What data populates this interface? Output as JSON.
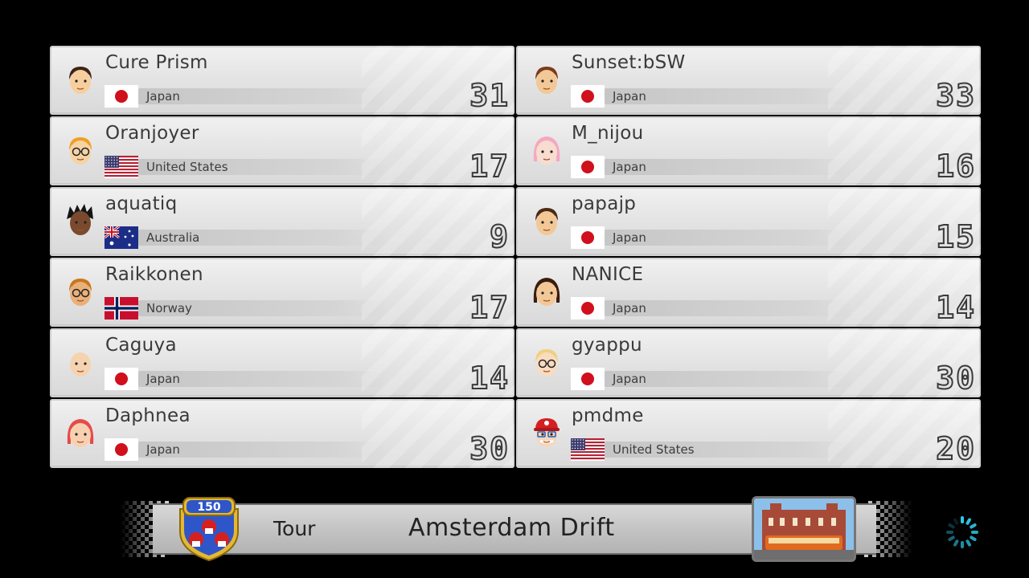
{
  "players": [
    {
      "name": "Cure Prism",
      "country": "Japan",
      "flag": "jp",
      "score": "31",
      "avatar": "mii-brown-hair-icon",
      "skin": "#f7cf9e",
      "hair": "#3b2416"
    },
    {
      "name": "Sunset:bSW",
      "country": "Japan",
      "flag": "jp",
      "score": "33",
      "avatar": "mii-auburn-hair-icon",
      "skin": "#f3c897",
      "hair": "#7a3b1c"
    },
    {
      "name": "Oranjoyer",
      "country": "United States",
      "flag": "us",
      "score": "17",
      "avatar": "mii-glasses-blonde-icon",
      "skin": "#f6d3a4",
      "hair": "#f0a020"
    },
    {
      "name": "M_nijou",
      "country": "Japan",
      "flag": "jp",
      "score": "16",
      "avatar": "mii-pink-hair-icon",
      "skin": "#f8dcd0",
      "hair": "#f4a9c0"
    },
    {
      "name": "aquatiq",
      "country": "Australia",
      "flag": "au",
      "score": "9",
      "avatar": "mii-dark-spiky-icon",
      "skin": "#7a4a2e",
      "hair": "#141414"
    },
    {
      "name": "papajp",
      "country": "Japan",
      "flag": "jp",
      "score": "15",
      "avatar": "mii-brown-hair-icon",
      "skin": "#f3c897",
      "hair": "#4a2a16"
    },
    {
      "name": "Raikkonen",
      "country": "Norway",
      "flag": "no",
      "score": "17",
      "avatar": "mii-sunglasses-icon",
      "skin": "#e9b07a",
      "hair": "#c8771f"
    },
    {
      "name": "NANICE",
      "country": "Japan",
      "flag": "jp",
      "score": "14",
      "avatar": "mii-long-hair-icon",
      "skin": "#f3c897",
      "hair": "#3a1d10"
    },
    {
      "name": "Caguya",
      "country": "Japan",
      "flag": "jp",
      "score": "14",
      "avatar": "mii-bald-icon",
      "skin": "#f6d3b0",
      "hair": "#f6d3b0"
    },
    {
      "name": "gyappu",
      "country": "Japan",
      "flag": "jp",
      "score": "30",
      "avatar": "mii-blonde-glasses-icon",
      "skin": "#f8dcc0",
      "hair": "#f0d080"
    },
    {
      "name": "Daphnea",
      "country": "Japan",
      "flag": "jp",
      "score": "30",
      "avatar": "mii-red-hair-icon",
      "skin": "#f8d0b0",
      "hair": "#e64a4a"
    },
    {
      "name": "pmdme",
      "country": "United States",
      "flag": "us",
      "score": "20",
      "avatar": "mii-red-cap-icon",
      "skin": "#f7d6b8",
      "hair": "#d42020"
    }
  ],
  "banner": {
    "cc_label": "150",
    "cup_label": "Tour",
    "track_name": "Amsterdam Drift"
  },
  "colors": {
    "card": "#e4e4e4",
    "text": "#3a3a3a",
    "accent_loading": "#2ec8e8",
    "badge_blue": "#2f56c8",
    "badge_gold": "#e6b830"
  }
}
